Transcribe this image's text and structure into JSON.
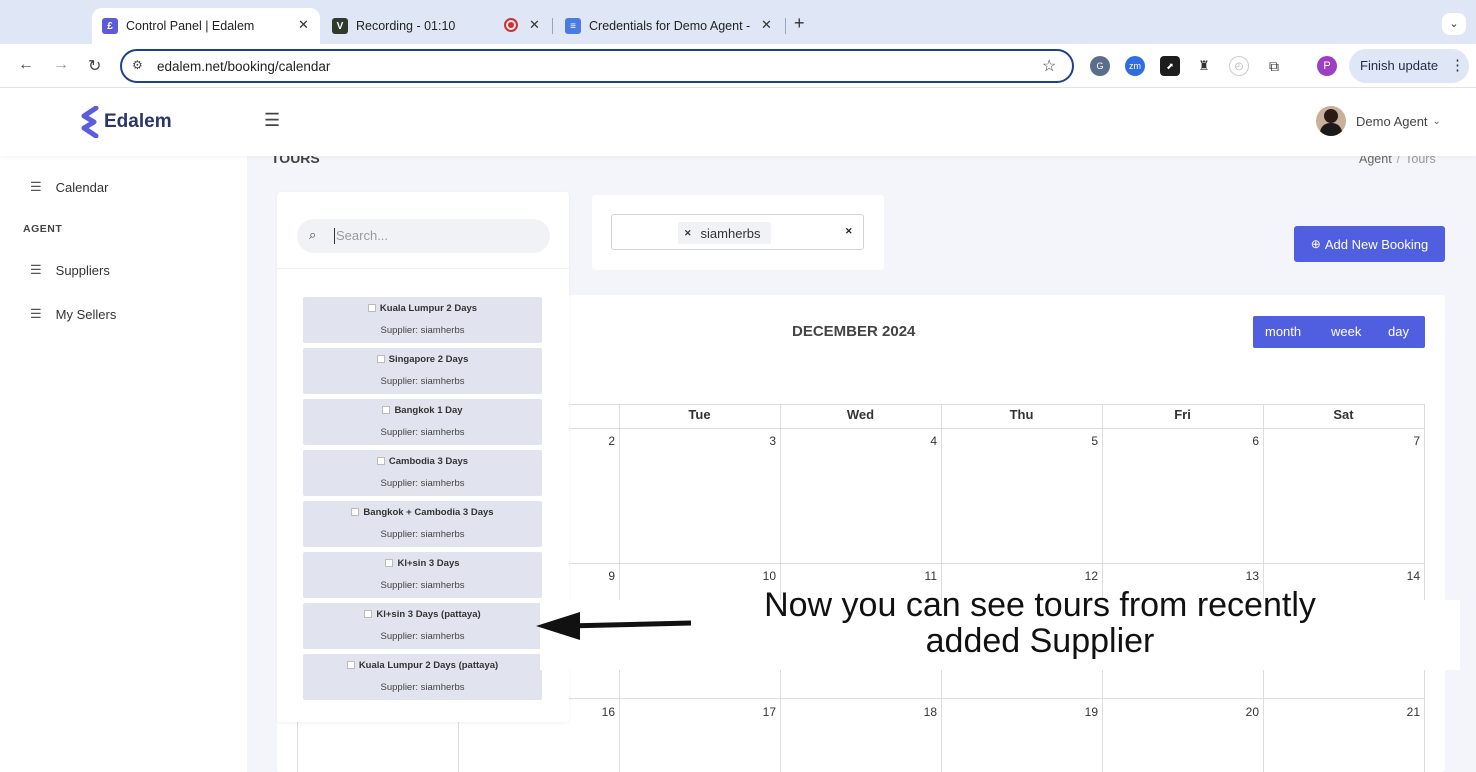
{
  "browser": {
    "tabs": [
      {
        "title": "Control Panel | Edalem",
        "icon": "edalem-logo-icon",
        "color": "#5b5bd6"
      },
      {
        "title": "Recording - 01:10",
        "icon": "recording-app-icon",
        "color": "#2f3b2a"
      },
      {
        "title": "Credentials for Demo Agent -",
        "icon": "docs-icon",
        "color": "#4a7be0"
      }
    ],
    "url": "edalem.net/booking/calendar",
    "finish_update": "Finish update",
    "profile_initial": "P"
  },
  "header": {
    "brand": "Edalem",
    "user_name": "Demo Agent"
  },
  "sidebar": {
    "items_top": [
      {
        "label": "Calendar"
      }
    ],
    "section": "AGENT",
    "items": [
      {
        "label": "Suppliers"
      },
      {
        "label": "My Sellers"
      }
    ]
  },
  "page": {
    "title": "TOURS",
    "breadcrumb": [
      "Agent",
      "/",
      "Tours"
    ],
    "search_placeholder": "Search...",
    "supplier_tag": "siamherbs",
    "add_booking": "Add New Booking"
  },
  "tours": [
    {
      "name": "Kuala Lumpur 2 Days",
      "supplier": "Supplier: siamherbs"
    },
    {
      "name": "Singapore 2 Days",
      "supplier": "Supplier: siamherbs"
    },
    {
      "name": "Bangkok 1 Day",
      "supplier": "Supplier: siamherbs"
    },
    {
      "name": "Cambodia 3 Days",
      "supplier": "Supplier: siamherbs"
    },
    {
      "name": "Bangkok + Cambodia 3 Days",
      "supplier": "Supplier: siamherbs"
    },
    {
      "name": "Kl+sin 3 Days",
      "supplier": "Supplier: siamherbs"
    },
    {
      "name": "Kl+sin 3 Days (pattaya)",
      "supplier": "Supplier: siamherbs"
    },
    {
      "name": "Kuala Lumpur 2 Days (pattaya)",
      "supplier": "Supplier: siamherbs"
    }
  ],
  "calendar": {
    "month_title": "DECEMBER 2024",
    "views": [
      "month",
      "week",
      "day"
    ],
    "weekdays": [
      "Tue",
      "Wed",
      "Thu",
      "Fri",
      "Sat"
    ],
    "week1": [
      "2",
      "3",
      "4",
      "5",
      "6",
      "7"
    ],
    "week2": [
      "9",
      "10",
      "11",
      "12",
      "13",
      "14"
    ],
    "week3": [
      "16",
      "17",
      "18",
      "19",
      "20",
      "21"
    ]
  },
  "annotation": {
    "line1": "Now you can see tours from recently",
    "line2": "added Supplier"
  },
  "colors": {
    "accent": "#4f5fe0",
    "tag_bg": "#f1f2f6",
    "tour_bg": "#e1e4ef"
  }
}
